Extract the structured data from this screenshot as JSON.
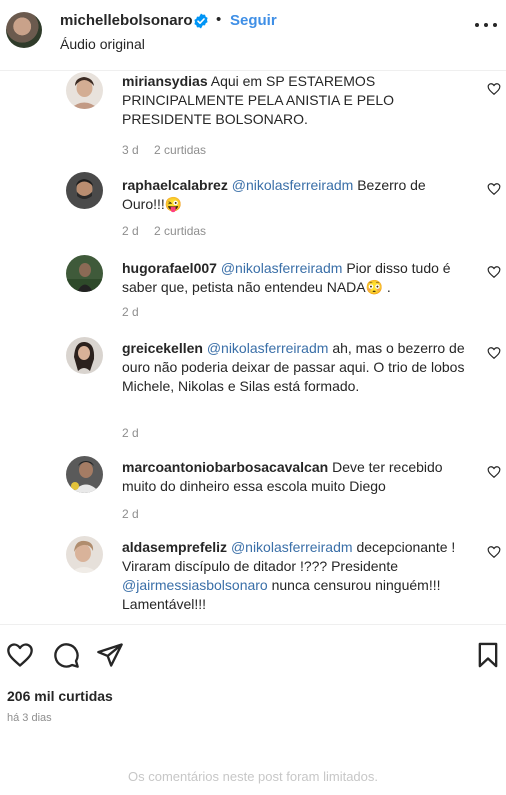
{
  "header": {
    "username": "michellebolsonaro",
    "separator": "•",
    "follow_label": "Seguir",
    "subtitle": "Áudio original"
  },
  "comments": [
    {
      "username": "miriansydias",
      "text": "Aqui em SP ESTAREMOS PRINCIPALMENTE PELA ANISTIA E PELO PRESIDENTE BOLSONARO.",
      "time": "3 d",
      "likes": "2 curtidas"
    },
    {
      "username": "raphaelcalabrez",
      "mention": "@nikolasferreiradm",
      "text": "Bezerro de Ouro!!!😜",
      "time": "2 d",
      "likes": "2 curtidas"
    },
    {
      "username": "hugorafael007",
      "mention": "@nikolasferreiradm",
      "text": "Pior disso tudo é saber que, petista não entendeu NADA😳 .",
      "time": "2 d"
    },
    {
      "username": "greicekellen",
      "mention": "@nikolasferreiradm",
      "text": "ah, mas o bezerro de ouro não poderia deixar de passar aqui. O trio de lobos Michele, Nikolas e Silas está formado.",
      "time": "2 d"
    },
    {
      "username": "marcoantoniobarbosacavalcan",
      "text": "Deve ter recebido muito do dinheiro essa escola muito Diego",
      "time": "2 d"
    },
    {
      "username": "aldasemprefeliz",
      "mention": "@nikolasferreiradm",
      "text": "decepcionante ! Viraram discípulo de ditador !??? Presidente",
      "mention2": "@jairmessiasbolsonaro",
      "text2": "nunca censurou ninguém!!! Lamentável!!!"
    }
  ],
  "post": {
    "likes_count": "206 mil curtidas",
    "time_ago": "há 3 dias",
    "limited_notice": "Os comentários neste post foram limitados."
  },
  "icons": [
    "verified-icon",
    "more-icon",
    "heart-icon",
    "comment-icon",
    "share-icon",
    "bookmark-icon"
  ],
  "colors": {
    "follow": "#3f8fe6",
    "mention": "#3a6fa8",
    "meta": "#8e8e8e"
  }
}
